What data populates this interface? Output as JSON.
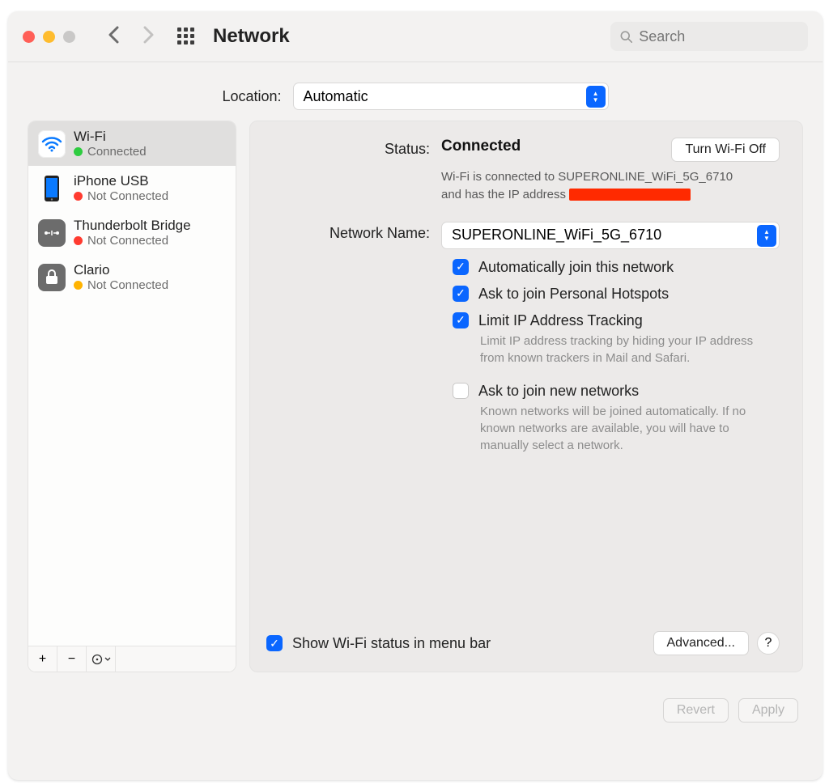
{
  "header": {
    "title": "Network",
    "search_placeholder": "Search"
  },
  "location": {
    "label": "Location:",
    "value": "Automatic"
  },
  "sidebar": {
    "services": [
      {
        "name": "Wi-Fi",
        "status": "Connected",
        "dot": "green",
        "icon": "wifi",
        "selected": true
      },
      {
        "name": "iPhone USB",
        "status": "Not Connected",
        "dot": "red",
        "icon": "iphone",
        "selected": false
      },
      {
        "name": "Thunderbolt Bridge",
        "status": "Not Connected",
        "dot": "red",
        "icon": "thunderbolt",
        "selected": false
      },
      {
        "name": "Clario",
        "status": "Not Connected",
        "dot": "orange",
        "icon": "lock",
        "selected": false
      }
    ],
    "footer": {
      "add": "+",
      "remove": "−",
      "menu": "⊙⌄"
    }
  },
  "detail": {
    "status_label": "Status:",
    "status_value": "Connected",
    "turn_off": "Turn Wi-Fi Off",
    "status_desc_prefix": "Wi-Fi is connected to SUPERONLINE_WiFi_5G_6710 and has the IP address ",
    "network_label": "Network Name:",
    "network_value": "SUPERONLINE_WiFi_5G_6710",
    "checks": {
      "auto_join": "Automatically join this network",
      "ask_hotspots": "Ask to join Personal Hotspots",
      "limit_ip": "Limit IP Address Tracking",
      "limit_ip_desc": "Limit IP address tracking by hiding your IP address from known trackers in Mail and Safari.",
      "ask_new": "Ask to join new networks",
      "ask_new_desc": "Known networks will be joined automatically. If no known networks are available, you will have to manually select a network."
    },
    "show_menu": "Show Wi-Fi status in menu bar",
    "advanced": "Advanced...",
    "help": "?"
  },
  "footer": {
    "revert": "Revert",
    "apply": "Apply"
  }
}
